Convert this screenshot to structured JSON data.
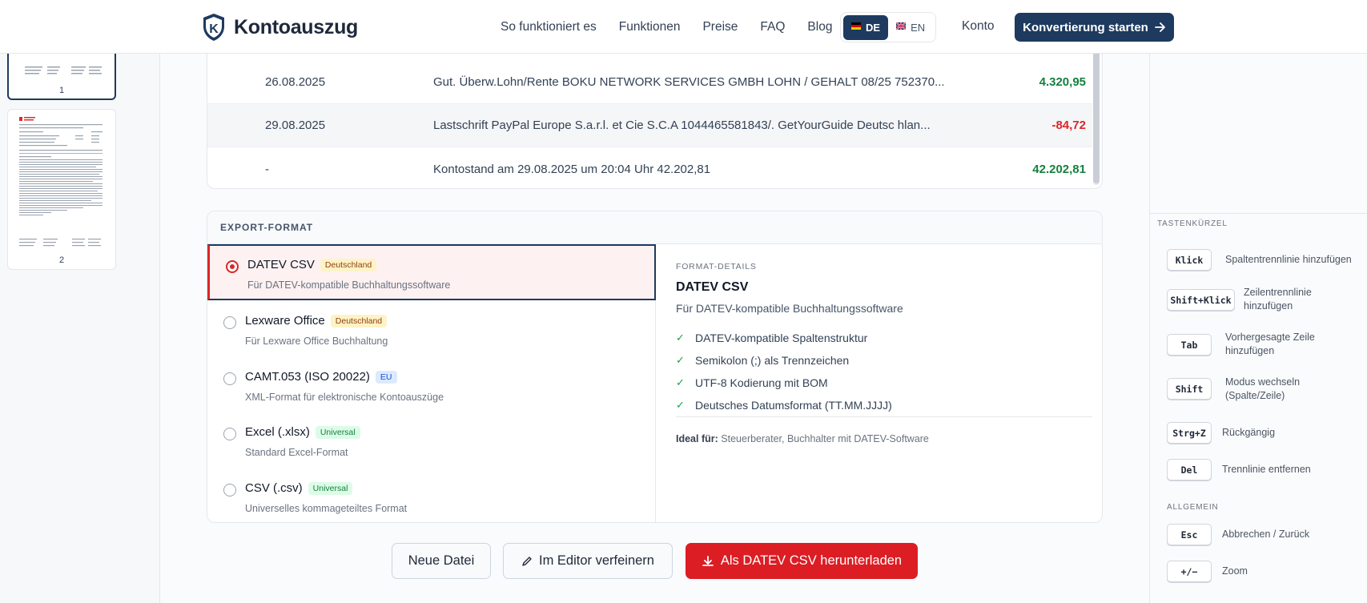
{
  "nav": {
    "brand": "Kontoauszug",
    "links": [
      "So funktioniert es",
      "Funktionen",
      "Preise",
      "FAQ",
      "Blog"
    ],
    "lang_active": "DE",
    "lang_inactive": "EN",
    "konto": "Konto",
    "cta": "Konvertierung starten"
  },
  "pages": {
    "items": [
      {
        "label": "1"
      },
      {
        "label": "2"
      }
    ]
  },
  "transactions": [
    {
      "date": "26.08.2025",
      "description": "Gut. Überw.Lohn/Rente BOKU NETWORK SERVICES GMBH LOHN / GEHALT 08/25 752370...",
      "amount": "4.320,95"
    },
    {
      "date": "29.08.2025",
      "description": "Lastschrift PayPal Europe S.a.r.l. et Cie S.C.A 1044465581843/. GetYourGuide Deutsc hlan...",
      "amount": "-84,72"
    },
    {
      "date": "-",
      "description": "Kontostand am 29.08.2025 um 20:04 Uhr 42.202,81",
      "amount": "42.202,81"
    }
  ],
  "export": {
    "header": "EXPORT-FORMAT",
    "options": [
      {
        "title": "DATEV CSV",
        "badge": "Deutschland",
        "sub": "Für DATEV-kompatible Buchhaltungssoftware",
        "selected": true
      },
      {
        "title": "Lexware Office",
        "badge": "Deutschland",
        "sub": "Für Lexware Office Buchhaltung",
        "selected": false
      },
      {
        "title": "CAMT.053 (ISO 20022)",
        "badge": "EU",
        "sub": "XML-Format für elektronische Kontoauszüge",
        "selected": false
      },
      {
        "title": "Excel (.xlsx)",
        "badge": "Universal",
        "sub": "Standard Excel-Format",
        "selected": false
      },
      {
        "title": "CSV (.csv)",
        "badge": "Universal",
        "sub": "Universelles kommageteiltes Format",
        "selected": false
      }
    ],
    "details": {
      "label": "FORMAT-DETAILS",
      "title": "DATEV CSV",
      "desc": "Für DATEV-kompatible Buchhaltungssoftware",
      "features": [
        "DATEV-kompatible Spaltenstruktur",
        "Semikolon (;) als Trennzeichen",
        "UTF-8 Kodierung mit BOM",
        "Deutsches Datumsformat (TT.MM.JJJJ)"
      ],
      "ideal_label": "Ideal für:",
      "ideal_value": "Steuerberater, Buchhalter mit DATEV-Software"
    }
  },
  "actions": {
    "new_file": "Neue Datei",
    "editor": "Im Editor verfeinern",
    "download": "Als DATEV CSV herunterladen"
  },
  "shortcuts": {
    "heading": "TASTENKÜRZEL",
    "items": [
      {
        "key": "Klick",
        "desc": "Spaltentrennlinie hinzufügen"
      },
      {
        "key": "Shift+Klick",
        "desc": "Zeilentrennlinie hinzufügen"
      },
      {
        "key": "Tab",
        "desc": "Vorhergesagte Zeile hinzufügen"
      },
      {
        "key": "Shift",
        "desc": "Modus wechseln (Spalte/Zeile)"
      },
      {
        "key": "Strg+Z",
        "desc": "Rückgängig"
      },
      {
        "key": "Del",
        "desc": "Trennlinie entfernen"
      }
    ],
    "general_heading": "ALLGEMEIN",
    "general": [
      {
        "key": "Esc",
        "desc": "Abbrechen / Zurück"
      },
      {
        "key": "+/−",
        "desc": "Zoom"
      }
    ]
  },
  "colors": {
    "navy": "#1e3a5f",
    "red": "#dc1d24",
    "positive": "#15803d",
    "negative": "#dc2626"
  }
}
